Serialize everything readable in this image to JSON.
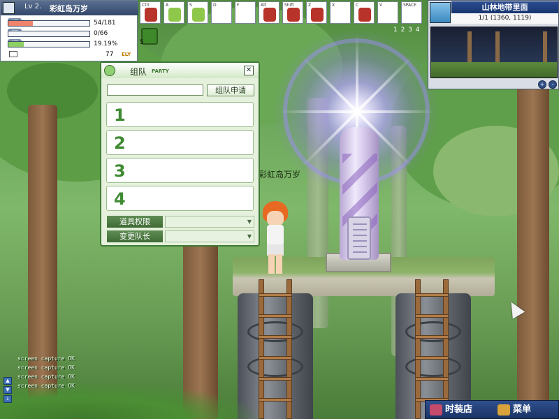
{
  "status": {
    "level": "Lv 2.",
    "character_name": "彩虹岛万岁",
    "stats": [
      {
        "label": "HP",
        "value": "54/181",
        "fraction": 0.298,
        "color": "#f0836c"
      },
      {
        "label": "SP",
        "value": "0/66",
        "fraction": 0.0,
        "color": "#6e9bd8"
      },
      {
        "label": "XP",
        "value": "19.19%",
        "fraction": 0.1919,
        "color": "#8dcf63"
      }
    ],
    "money": "77",
    "money_unit": "ELY"
  },
  "hotkeys": [
    {
      "key": "Ctrl",
      "icon": "sword-icon",
      "color": "#b8332a"
    },
    {
      "key": "A",
      "icon": "character-face-icon",
      "color": "#8fc74a"
    },
    {
      "key": "S",
      "icon": "skill-arm-icon",
      "color": "#8fc74a"
    },
    {
      "key": "D",
      "icon": "empty-slot",
      "color": ""
    },
    {
      "key": "F",
      "icon": "empty-slot",
      "color": ""
    },
    {
      "key": "Alt",
      "icon": "sword-icon",
      "color": "#b8332a"
    },
    {
      "key": "Shift",
      "icon": "sword-icon",
      "color": "#b8332a"
    },
    {
      "key": "Z",
      "icon": "running-icon",
      "color": "#b8332a"
    },
    {
      "key": "X",
      "icon": "empty-slot",
      "color": ""
    },
    {
      "key": "C",
      "icon": "kick-icon",
      "color": "#b8332a"
    },
    {
      "key": "V",
      "icon": "empty-slot",
      "color": ""
    },
    {
      "key": "SPACE",
      "icon": "empty-slot",
      "color": ""
    }
  ],
  "skill_slot": {
    "level": "5",
    "icon": "green-skill-icon"
  },
  "page_numbers": "1 2 3 4",
  "minimap": {
    "title": "山林地带里面",
    "coords": "1/1 (1360, 1119)",
    "zoom_in": "+",
    "zoom_out": "-"
  },
  "party": {
    "title": "组队",
    "subtitle": "PARTY",
    "close": "✕",
    "search_value": "",
    "apply_label": "组队申请",
    "slots": [
      "1",
      "2",
      "3",
      "4"
    ],
    "options": [
      {
        "label": "道具权限",
        "value": ""
      },
      {
        "label": "变更队长",
        "value": ""
      }
    ]
  },
  "player": {
    "name_tag": "彩虹岛万岁"
  },
  "chat": {
    "lines": [
      "screen capture OK",
      "screen capture OK",
      "screen capture OK",
      "screen capture OK"
    ],
    "buttons": [
      "▲",
      "▼",
      "↓"
    ]
  },
  "bottom_bar": {
    "shop_label": "时装店",
    "menu_label": "菜单"
  }
}
